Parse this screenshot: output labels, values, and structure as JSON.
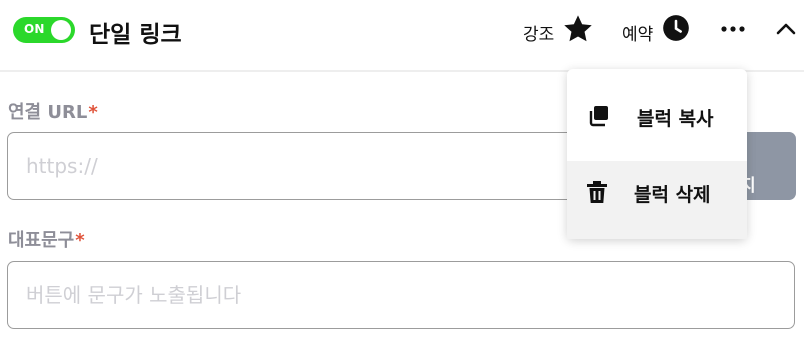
{
  "header": {
    "toggle_label": "ON",
    "title": "단일 링크",
    "highlight_label": "강조",
    "schedule_label": "예약"
  },
  "form": {
    "url_label": "연결 URL",
    "url_required": "*",
    "url_placeholder": "https://",
    "url_value": "",
    "go_button_partial": "지",
    "caption_label": "대표문구",
    "caption_required": "*",
    "caption_placeholder": "버튼에 문구가 노출됩니다",
    "caption_value": ""
  },
  "menu": {
    "items": [
      {
        "label": "블럭 복사",
        "icon": "copy-icon"
      },
      {
        "label": "블럭 삭제",
        "icon": "trash-icon",
        "active": true
      }
    ]
  },
  "colors": {
    "toggle_on": "#2bd82b",
    "required": "#e0533a",
    "button_gray": "#8e96a4",
    "label_gray": "#8e8e98"
  }
}
